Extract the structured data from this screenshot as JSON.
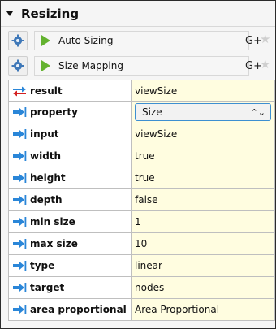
{
  "section": {
    "title": "Resizing"
  },
  "algorithms": [
    {
      "label": "Auto Sizing",
      "extra": "G+"
    },
    {
      "label": "Size Mapping",
      "extra": "G+"
    }
  ],
  "params": [
    {
      "label": "result",
      "value": "viewSize",
      "direction": "out"
    },
    {
      "label": "property",
      "value": "Size",
      "direction": "in",
      "control": "select"
    },
    {
      "label": "input",
      "value": "viewSize",
      "direction": "in"
    },
    {
      "label": "width",
      "value": "true",
      "direction": "in"
    },
    {
      "label": "height",
      "value": "true",
      "direction": "in"
    },
    {
      "label": "depth",
      "value": "false",
      "direction": "in"
    },
    {
      "label": "min size",
      "value": "1",
      "direction": "in"
    },
    {
      "label": "max size",
      "value": "10",
      "direction": "in"
    },
    {
      "label": "type",
      "value": "linear",
      "direction": "in"
    },
    {
      "label": "target",
      "value": "nodes",
      "direction": "in"
    },
    {
      "label": "area proportional",
      "value": "Area Proportional",
      "direction": "in"
    }
  ],
  "colors": {
    "value_bg": "#fffde0",
    "play_green": "#63b22f",
    "arrow_blue": "#2a86d8",
    "arrow_red": "#d42020",
    "select_border": "#3d8fd1"
  }
}
